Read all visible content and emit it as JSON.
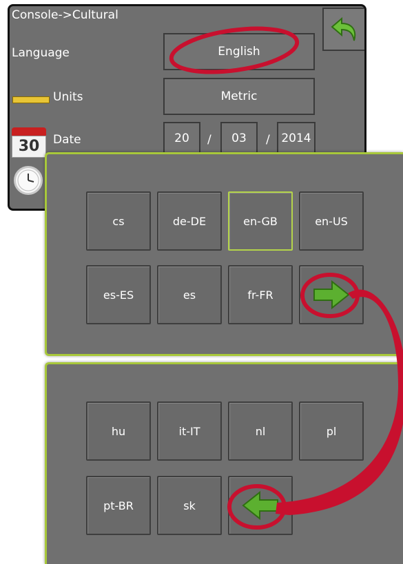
{
  "console": {
    "title": "Console->Cultural",
    "language_label": "Language",
    "language_value": "English",
    "units_label": "Units",
    "units_value": "Metric",
    "date_label": "Date",
    "date_day": "20",
    "date_month": "03",
    "date_year": "2014",
    "date_separator": "/",
    "calendar_number": "30"
  },
  "panel1": {
    "keys": [
      "cs",
      "de-DE",
      "en-GB",
      "en-US",
      "es-ES",
      "es",
      "fr-FR"
    ],
    "selected": "en-GB",
    "next_icon": "arrow-right-icon"
  },
  "panel2": {
    "keys": [
      "hu",
      "it-IT",
      "nl",
      "pl",
      "pt-BR",
      "sk"
    ],
    "prev_icon": "arrow-left-icon"
  },
  "colors": {
    "panel_border": "#a8c83a",
    "highlight": "#c8102e",
    "arrow_green": "#5cb030"
  }
}
